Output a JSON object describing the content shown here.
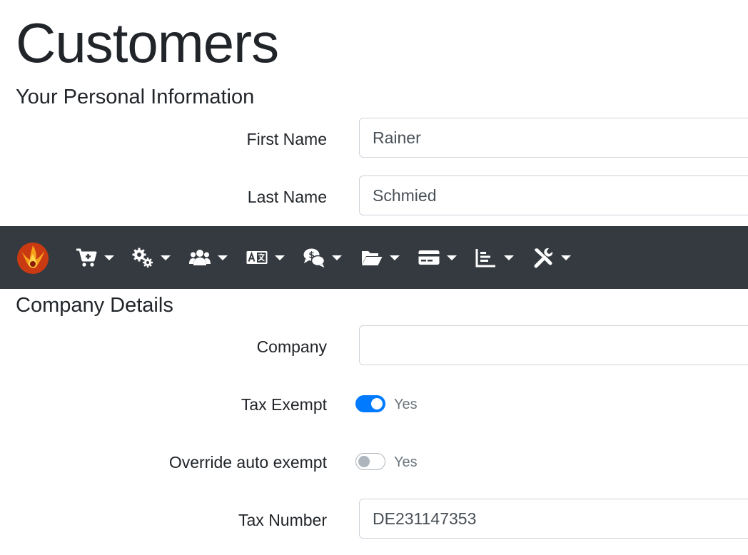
{
  "page": {
    "title": "Customers"
  },
  "personal": {
    "heading": "Your Personal Information",
    "first_name": {
      "label": "First Name",
      "value": "Rainer"
    },
    "last_name": {
      "label": "Last Name",
      "value": "Schmied"
    }
  },
  "navbar": {
    "logo_icon": "phoenix-logo-icon",
    "items": [
      {
        "icon": "cart-plus-icon"
      },
      {
        "icon": "cogs-icon"
      },
      {
        "icon": "users-icon"
      },
      {
        "icon": "language-icon"
      },
      {
        "icon": "comments-dollar-icon"
      },
      {
        "icon": "folder-open-icon"
      },
      {
        "icon": "credit-card-icon"
      },
      {
        "icon": "chart-bar-icon"
      },
      {
        "icon": "tools-icon"
      }
    ],
    "background": "#343a40",
    "icon_color": "#ffffff"
  },
  "company": {
    "heading": "Company Details",
    "company": {
      "label": "Company",
      "value": ""
    },
    "tax_exempt": {
      "label": "Tax Exempt",
      "switch_label": "Yes",
      "checked": true
    },
    "override_auto_exempt": {
      "label": "Override auto exempt",
      "switch_label": "Yes",
      "checked": false
    },
    "tax_number": {
      "label": "Tax Number",
      "value": "DE231147353"
    }
  },
  "colors": {
    "accent": "#007bff",
    "text": "#212529",
    "muted": "#6c757d",
    "input_border": "#ced4da"
  }
}
